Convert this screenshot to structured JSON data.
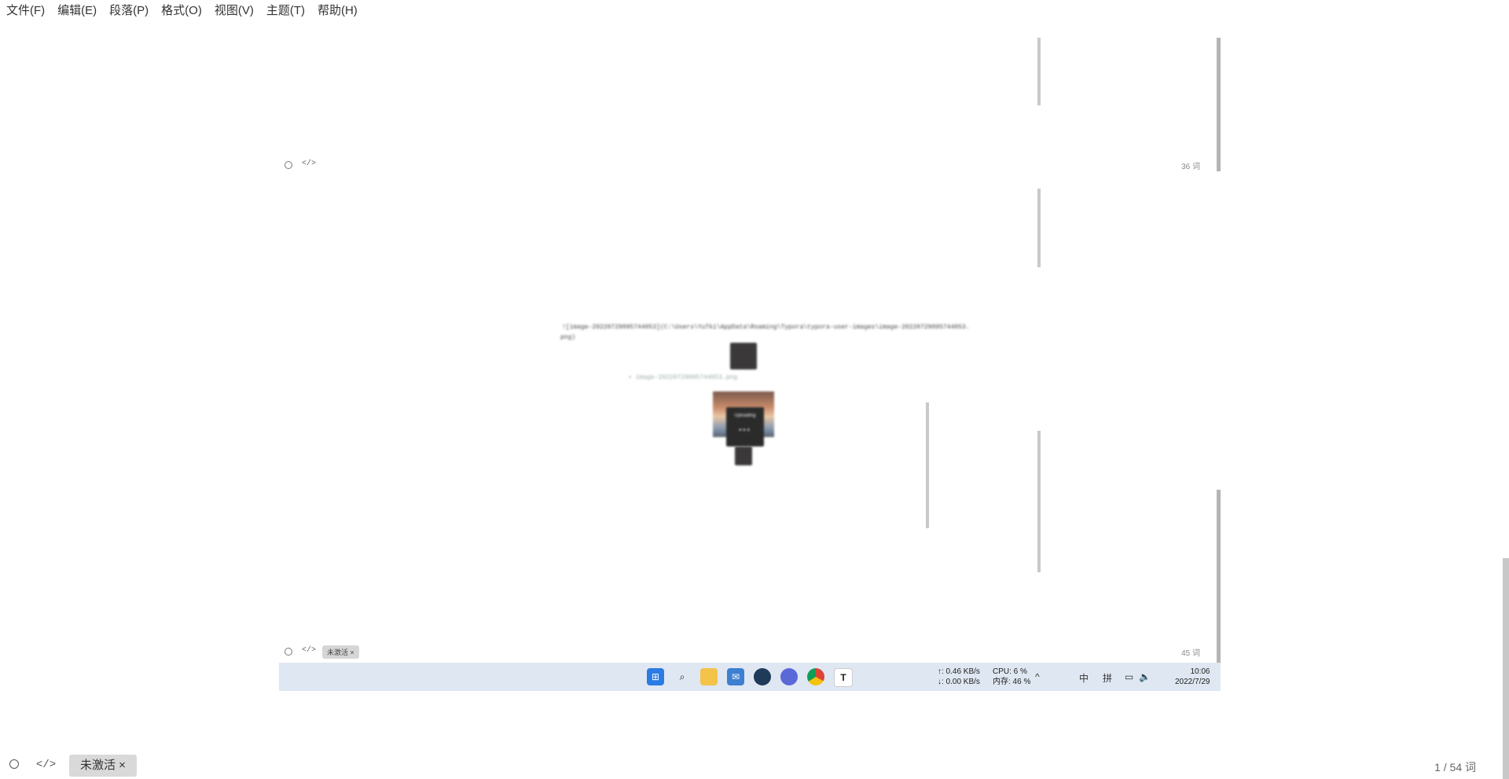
{
  "menu": {
    "file": "文件(F)",
    "edit": "编辑(E)",
    "paragraph": "段落(P)",
    "format": "格式(O)",
    "view": "视图(V)",
    "theme": "主题(T)",
    "help": "帮助(H)"
  },
  "nested": {
    "count_top": "36 词",
    "count_bottom": "45 词",
    "badge": "未激活 ×",
    "code_icon": "</>",
    "markdown_line1": "![image-20220729095744053](C:\\Users\\YuTki\\AppData\\Roaming\\Typora\\typora-user-images\\image-20220729095744053.",
    "markdown_line2": "png)",
    "uploading": "Uploading",
    "taskbar": {
      "net_up": "↑: 0.46 KB/s",
      "net_down": "↓: 0.00 KB/s",
      "cpu": "CPU: 6 %",
      "mem": "内存: 46 %",
      "ime_lang": "中",
      "ime_mode": "拼",
      "time": "10:06",
      "date": "2022/7/29"
    }
  },
  "statusbar": {
    "code_icon": "</>",
    "badge": "未激活 ×",
    "word_count": "1 / 54 词"
  },
  "icons": [
    "circle-icon",
    "code-icon",
    "windows-start-icon",
    "search-icon",
    "folder-icon",
    "mail-icon",
    "steam-icon",
    "browser-icon",
    "chrome-icon",
    "typora-icon"
  ]
}
